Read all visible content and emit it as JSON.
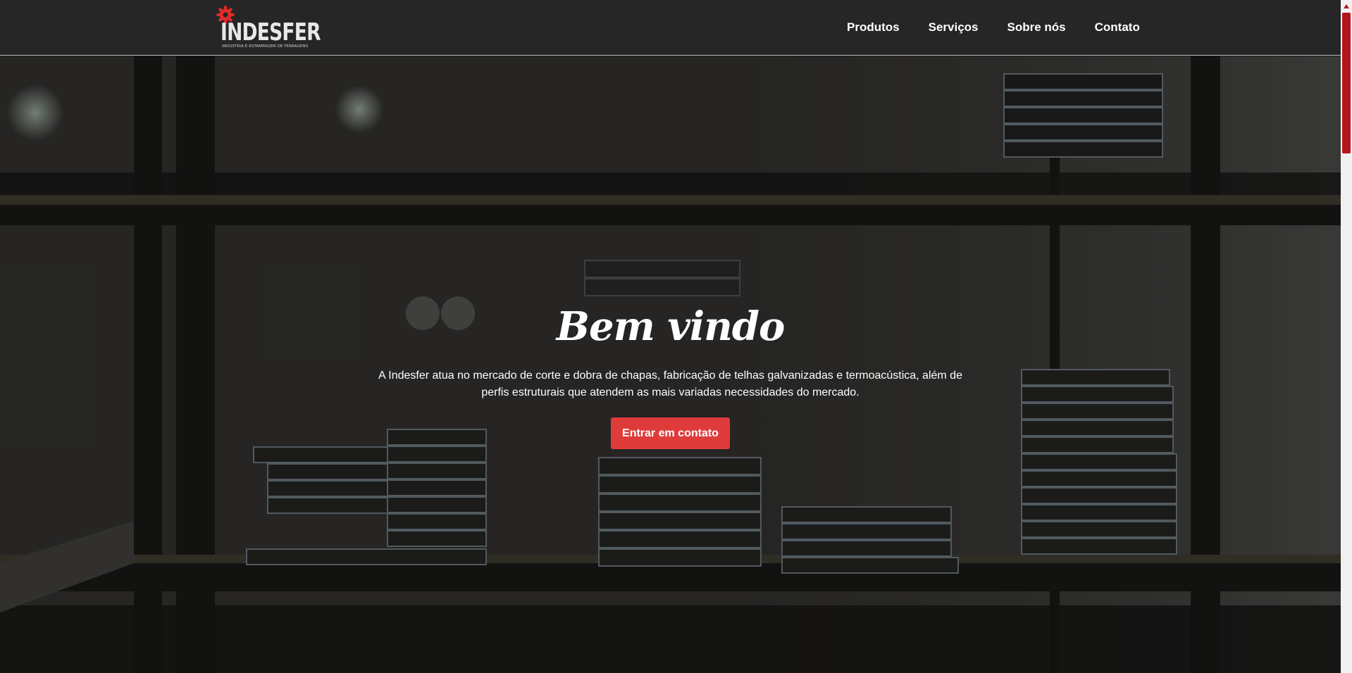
{
  "brand": {
    "name": "INDESFER",
    "tagline": "INDUSTRIA E ESTAMPAGEM DE FERRAGENS",
    "gear_color": "#e32b2b"
  },
  "nav": {
    "items": [
      {
        "label": "Produtos"
      },
      {
        "label": "Serviços"
      },
      {
        "label": "Sobre nós"
      },
      {
        "label": "Contato"
      }
    ]
  },
  "hero": {
    "title": "Bem vindo",
    "description": "A Indesfer atua no mercado de corte e dobra de chapas, fabricação de telhas galvanizadas e termoacústica, além de perfis estruturais que atendem as mais variadas necessidades do mercado.",
    "cta_label": "Entrar em contato",
    "cta_color": "#e03b3b"
  },
  "icons": {
    "logo_gear": "gear-icon",
    "scroll_up": "chevron-up-icon"
  },
  "colors": {
    "header_bg": "#262626",
    "accent": "#b3151c"
  }
}
